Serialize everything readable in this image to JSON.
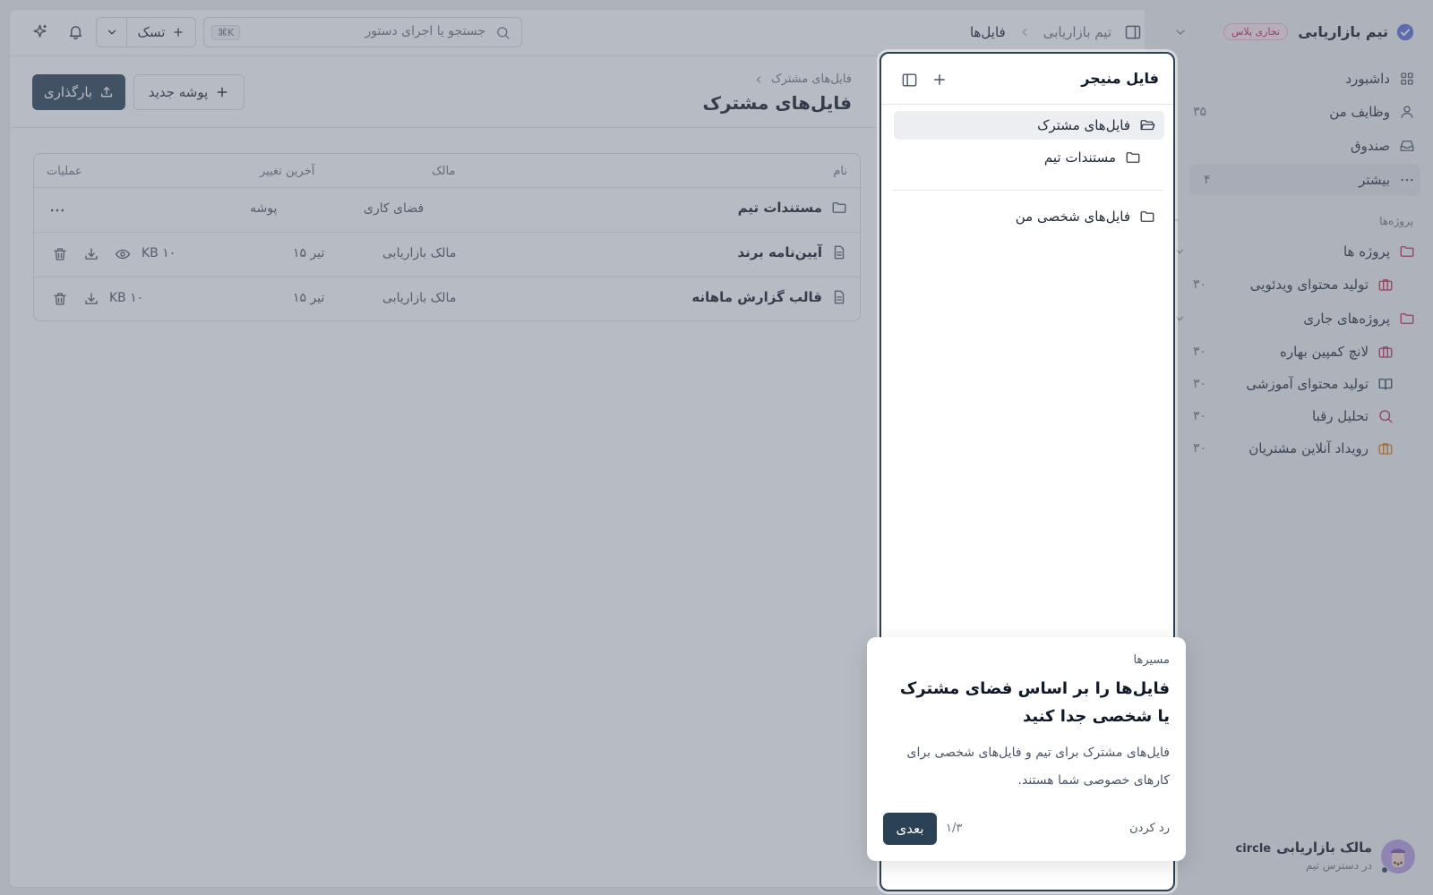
{
  "colors": {
    "accent": "#2b4155",
    "badge_bg": "#fde7ef",
    "badge_fg": "#c0264b",
    "project_icon": "#c0264b"
  },
  "workspace": {
    "name": "تیم بازاریابی",
    "plan_badge": "تجاری پلاس"
  },
  "nav": [
    {
      "label": "داشبورد",
      "icon": "grid-icon",
      "count": ""
    },
    {
      "label": "وظایف من",
      "icon": "user-icon",
      "count": "۳۵"
    },
    {
      "label": "صندوق",
      "icon": "inbox-icon",
      "count": ""
    },
    {
      "label": "بیشتر",
      "icon": "more-icon",
      "count": "۴"
    }
  ],
  "projects": {
    "section_label": "پروژه‌ها",
    "groups": [
      {
        "label": "پروژه ها"
      },
      {
        "label": "پروژه‌های جاری"
      }
    ],
    "items": [
      {
        "label": "تولید محتوای ویدئویی",
        "icon": "briefcase-icon",
        "count": "۳۰"
      },
      {
        "label": "لانچ کمپین بهاره",
        "icon": "briefcase-icon",
        "count": "۳۰"
      },
      {
        "label": "تولید محتوای آموزشی",
        "icon": "book-icon",
        "count": "۳۰"
      },
      {
        "label": "تحلیل رقبا",
        "icon": "search-icon",
        "count": "۳۰"
      },
      {
        "label": "رویداد آنلاین مشتریان",
        "icon": "briefcase-icon",
        "count": "۳۰"
      }
    ]
  },
  "user": {
    "name": "مالک بازاریابی",
    "tag": "circle",
    "subtitle": "در دسترس تیم"
  },
  "topbar": {
    "breadcrumb_root": "تیم بازاریابی",
    "breadcrumb_current": "فایل‌ها",
    "search_placeholder": "جستجو یا اجرای دستور",
    "search_shortcut": "⌘K",
    "task_button": "تسک"
  },
  "page": {
    "breadcrumb": "فایل‌های مشترک",
    "title": "فایل‌های مشترک",
    "new_folder_button": "پوشه جدید",
    "upload_button": "بارگذاری"
  },
  "table": {
    "headers": {
      "name": "نام",
      "owner": "مالک",
      "modified": "آخرین تغییر",
      "actions": "عملیات"
    },
    "rows": [
      {
        "name": "مستندات تیم",
        "type": "folder",
        "owner": "فضای کاری",
        "modified": "پوشه",
        "size": ""
      },
      {
        "name": "آیین‌نامه برند",
        "type": "file",
        "owner": "مالک بازاریابی",
        "modified": "۱۵ تیر",
        "size": "KB ۱۰"
      },
      {
        "name": "قالب گزارش ماهانه",
        "type": "file",
        "owner": "مالک بازاریابی",
        "modified": "۱۵ تیر",
        "size": "KB ۱۰"
      }
    ]
  },
  "file_manager": {
    "title": "فایل منیجر",
    "tree": [
      {
        "label": "فایل‌های مشترک",
        "icon": "folder-open-icon"
      },
      {
        "label": "مستندات تیم",
        "icon": "folder-icon"
      },
      {
        "label": "فایل‌های شخصی من",
        "icon": "folder-icon"
      }
    ]
  },
  "tour": {
    "eyebrow": "مسیرها",
    "title": "فایل‌ها را بر اساس فضای مشترک یا شخصی جدا کنید",
    "body": "فایل‌های مشترک برای تیم و فایل‌های شخصی برای کارهای خصوصی شما هستند.",
    "progress": "۱/۳",
    "next_button": "بعدی",
    "skip_button": "رد کردن"
  }
}
